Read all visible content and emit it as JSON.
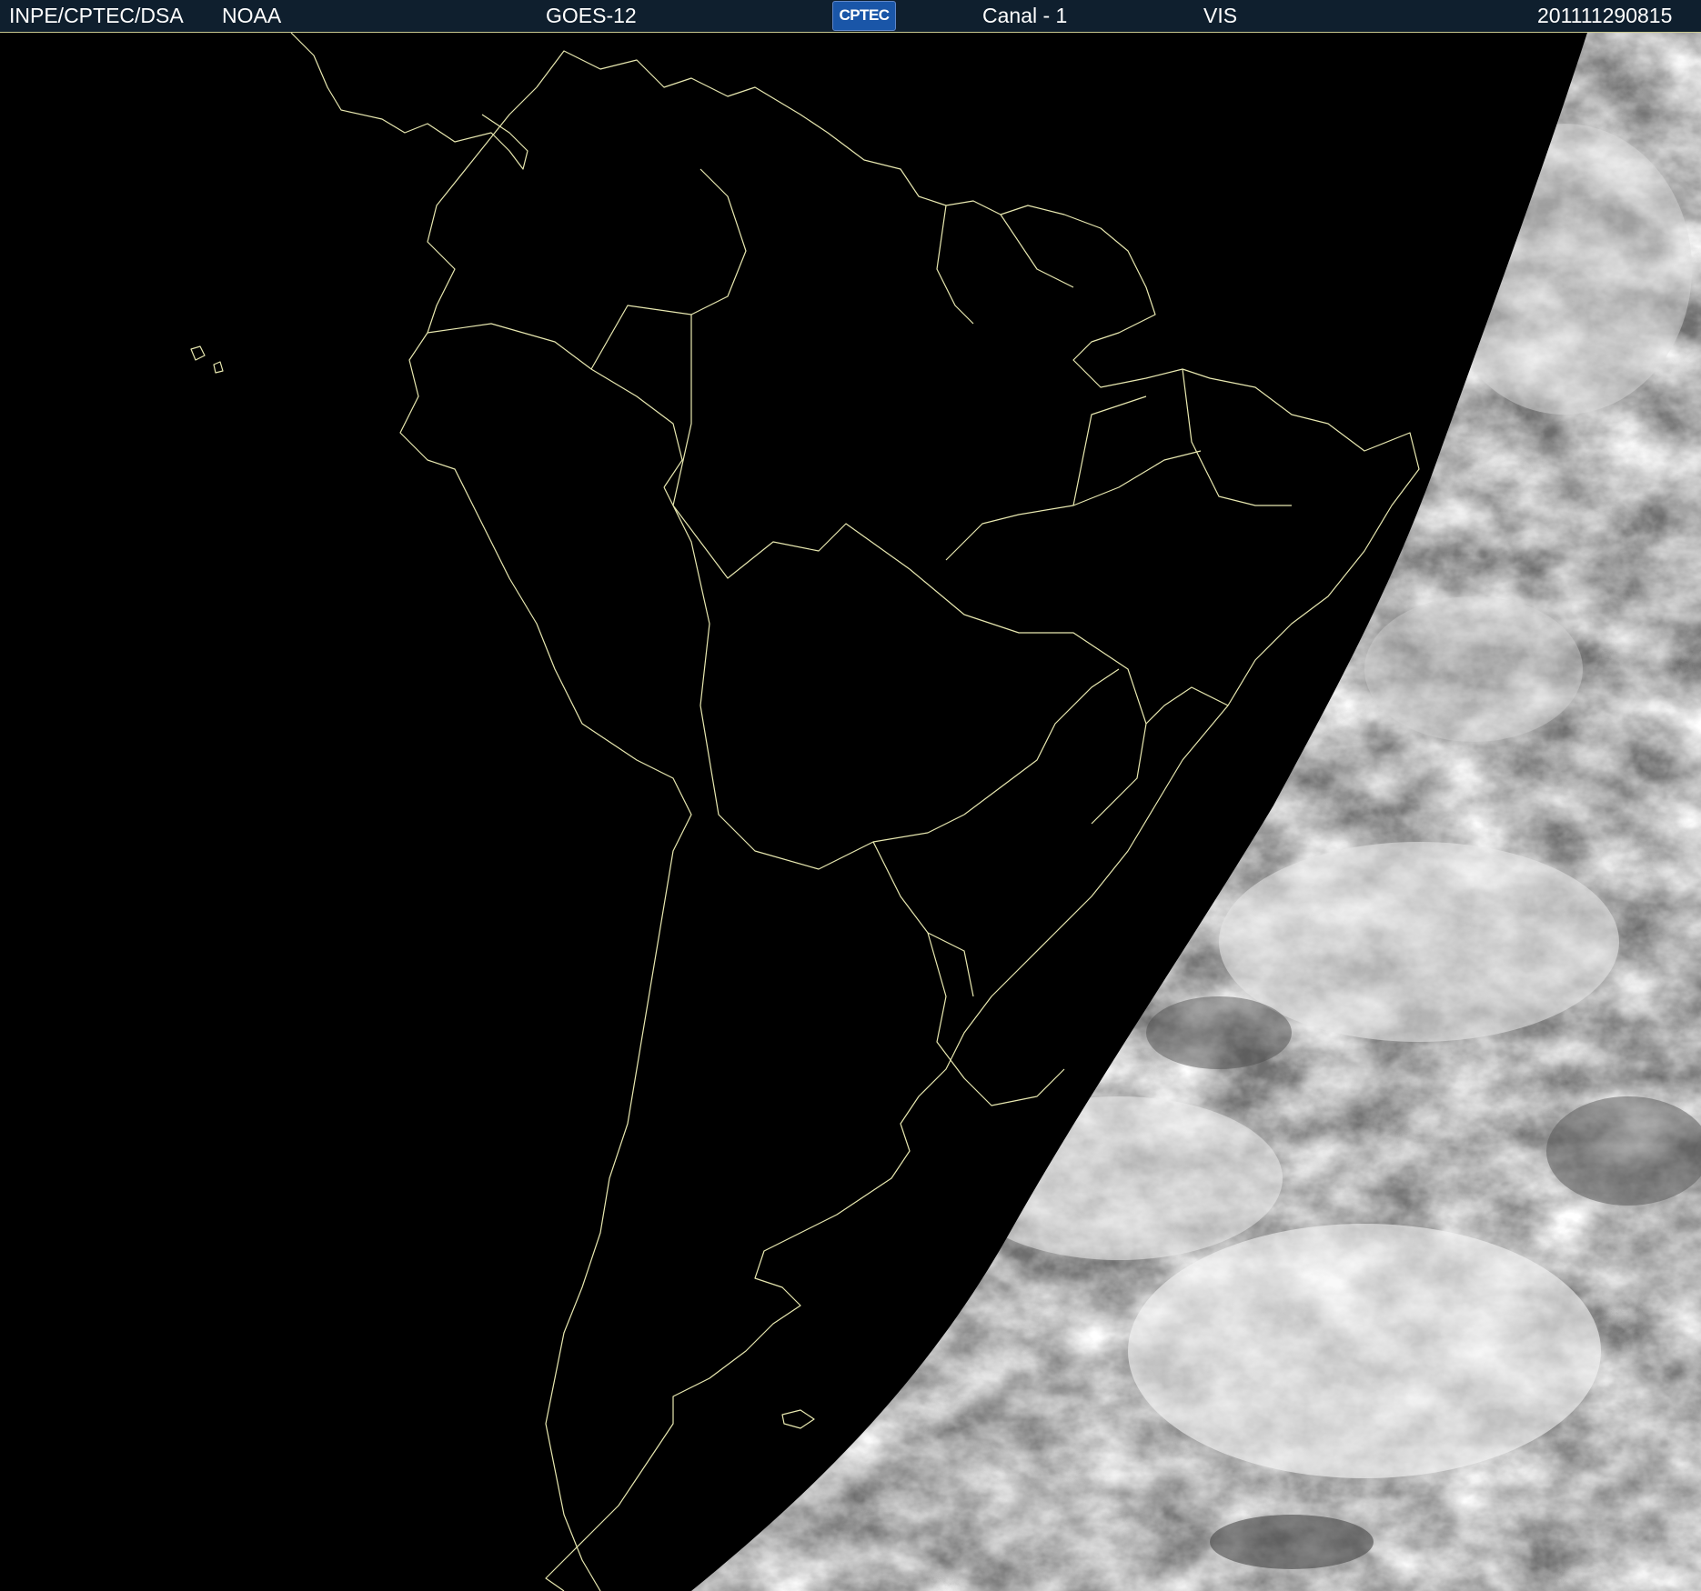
{
  "header": {
    "institute": "INPE/CPTEC/DSA",
    "agency": "NOAA",
    "satellite": "GOES-12",
    "logo_text": "CPTEC",
    "channel": "Canal - 1",
    "band": "VIS",
    "timestamp": "201111290815"
  },
  "colors": {
    "header_bg": "#0f1f2e",
    "coastline": "#e8e8b0",
    "space": "#000000",
    "clouds_light": "#f2f2f2",
    "clouds_dark": "#7a7a7a"
  },
  "icons": {
    "logo": "cptec-logo"
  }
}
